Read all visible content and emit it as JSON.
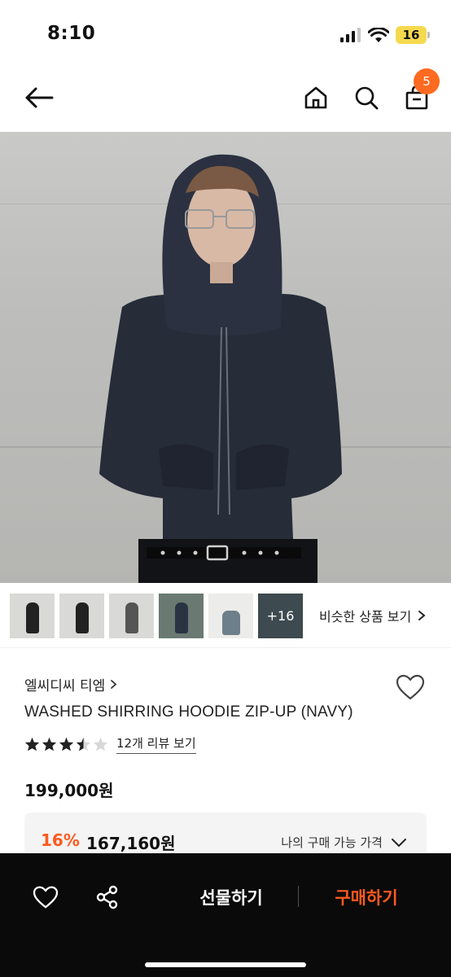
{
  "status_bar": {
    "time": "8:10",
    "battery": "16"
  },
  "header": {
    "cart_count": "5"
  },
  "gallery": {
    "more_count": "+16",
    "similar_label": "비슷한 상품 보기"
  },
  "product": {
    "brand": "엘씨디씨 티엠",
    "title": "WASHED SHIRRING HOODIE ZIP-UP (NAVY)",
    "rating": 3.5,
    "rating_max": 5,
    "review_link": "12개 리뷰 보기",
    "price": "199,000원",
    "discount_rate": "16%",
    "discount_price": "167,160원",
    "my_price_label": "나의 구매 가능 가격"
  },
  "bottom_bar": {
    "gift_label": "선물하기",
    "buy_label": "구매하기"
  },
  "colors": {
    "accent": "#ff5a1f",
    "badge": "#ff6a21",
    "bottom_bar": "#0a0a0a",
    "battery": "#f5d94e"
  }
}
